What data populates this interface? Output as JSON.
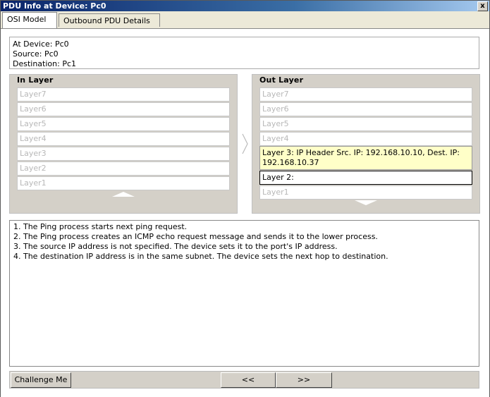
{
  "window": {
    "title": "PDU Info at Device: Pc0",
    "close_label": "x"
  },
  "tabs": [
    {
      "label": "OSI Model"
    },
    {
      "label": "Outbound PDU Details"
    }
  ],
  "info": {
    "at_device": "At Device: Pc0",
    "source": "Source: Pc0",
    "destination": "Destination: Pc1"
  },
  "in_layer": {
    "title": "In Layer",
    "layers": [
      "Layer7",
      "Layer6",
      "Layer5",
      "Layer4",
      "Layer3",
      "Layer2",
      "Layer1"
    ]
  },
  "out_layer": {
    "title": "Out Layer",
    "layers": [
      "Layer7",
      "Layer6",
      "Layer5",
      "Layer4"
    ],
    "layer3": "Layer 3: IP Header Src. IP: 192.168.10.10, Dest. IP: 192.168.10.37",
    "layer2": "Layer 2:",
    "layer1": "Layer1"
  },
  "steps": [
    "1. The Ping process starts next ping request.",
    "2. The Ping process creates an ICMP echo request message and sends it to the lower process.",
    "3. The source IP address is not specified. The device sets it to the port's IP address.",
    "4. The destination IP address is in the same subnet. The device sets the next hop to destination."
  ],
  "buttons": {
    "challenge": "Challenge Me",
    "prev": "<<",
    "next": ">>"
  }
}
